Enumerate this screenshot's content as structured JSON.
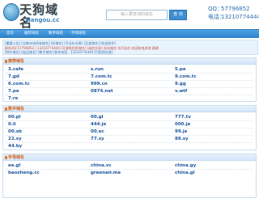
{
  "header": {
    "logo_text": "天狗域名",
    "logo_sub": "tiangou.cc",
    "search_placeholder": "输入要查询的域名",
    "search_button": "查 询",
    "qq_label": "QQ：",
    "qq_value": "57796852",
    "phone_label": "电话：",
    "phone_value": "13210774444"
  },
  "nav": {
    "items": [
      "首页",
      "推荐域名",
      "数字域名",
      "字母域名"
    ]
  },
  "notice": {
    "line1": "[重要公告] [出售本站所有域名] [好域名] [可议价交易] [买卖域名] [欢迎合作]",
    "line2": "联系QQ:57796852 | 13210774444 [可收购优质域名] [诚信交易] 本站域名 均可议价 欢迎来电咨询 谢谢",
    "line3": "[特价域名] [极品域名] [数字域名] 联系电话：13210774444 [可担保交易]"
  },
  "panels": [
    {
      "title": "推荐域名",
      "rows": [
        [
          "3.cafe",
          "s.run",
          "5.pe"
        ],
        [
          "7.gd",
          "7.com.tc",
          "9.com.tc"
        ],
        [
          "6.com.tc",
          "999.cn",
          "9.gg"
        ],
        [
          "7.pe",
          "0874.net",
          "v.wtf"
        ],
        [
          "7.re",
          "",
          ""
        ]
      ]
    },
    {
      "title": "数字域名",
      "rows": [
        [
          "00.pl",
          "00.gl",
          "777.tv"
        ],
        [
          "0.li",
          "444.je",
          "000.je"
        ],
        [
          "00.sb",
          "00.ec",
          "99.je"
        ],
        [
          "22.sy",
          "77.sy",
          "88.sy"
        ],
        [
          "44.by",
          "",
          ""
        ]
      ]
    },
    {
      "title": "字母域名",
      "rows": [
        [
          "ee.gl",
          "china.vc",
          "china.gy"
        ],
        [
          "baozheng.cc",
          "greenair.me",
          "china.gl"
        ]
      ]
    }
  ]
}
